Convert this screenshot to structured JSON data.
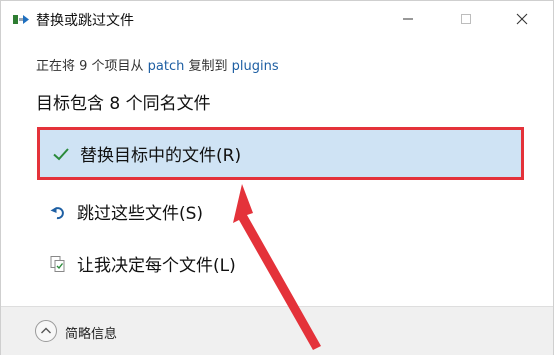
{
  "window": {
    "title": "替换或跳过文件",
    "min_icon": "minimize-icon",
    "max_icon": "maximize-icon",
    "close_icon": "close-icon"
  },
  "progress": {
    "prefix": "正在将 9 个项目从 ",
    "source": "patch",
    "middle": " 复制到 ",
    "destination": "plugins"
  },
  "heading": "目标包含 8 个同名文件",
  "options": [
    {
      "label": "替换目标中的文件(R)",
      "icon": "checkmark-icon"
    },
    {
      "label": "跳过这些文件(S)",
      "icon": "skip-arrow-icon"
    },
    {
      "label": "让我决定每个文件(L)",
      "icon": "decide-icon"
    }
  ],
  "footer": {
    "details_label": "简略信息",
    "details_icon": "chevron-up-icon"
  },
  "colors": {
    "selected_bg": "#cfe3f4",
    "highlight_border": "#e4323a",
    "link": "#1e5fa3",
    "check": "#2a8a3a",
    "annotation_arrow": "#e4323a"
  }
}
